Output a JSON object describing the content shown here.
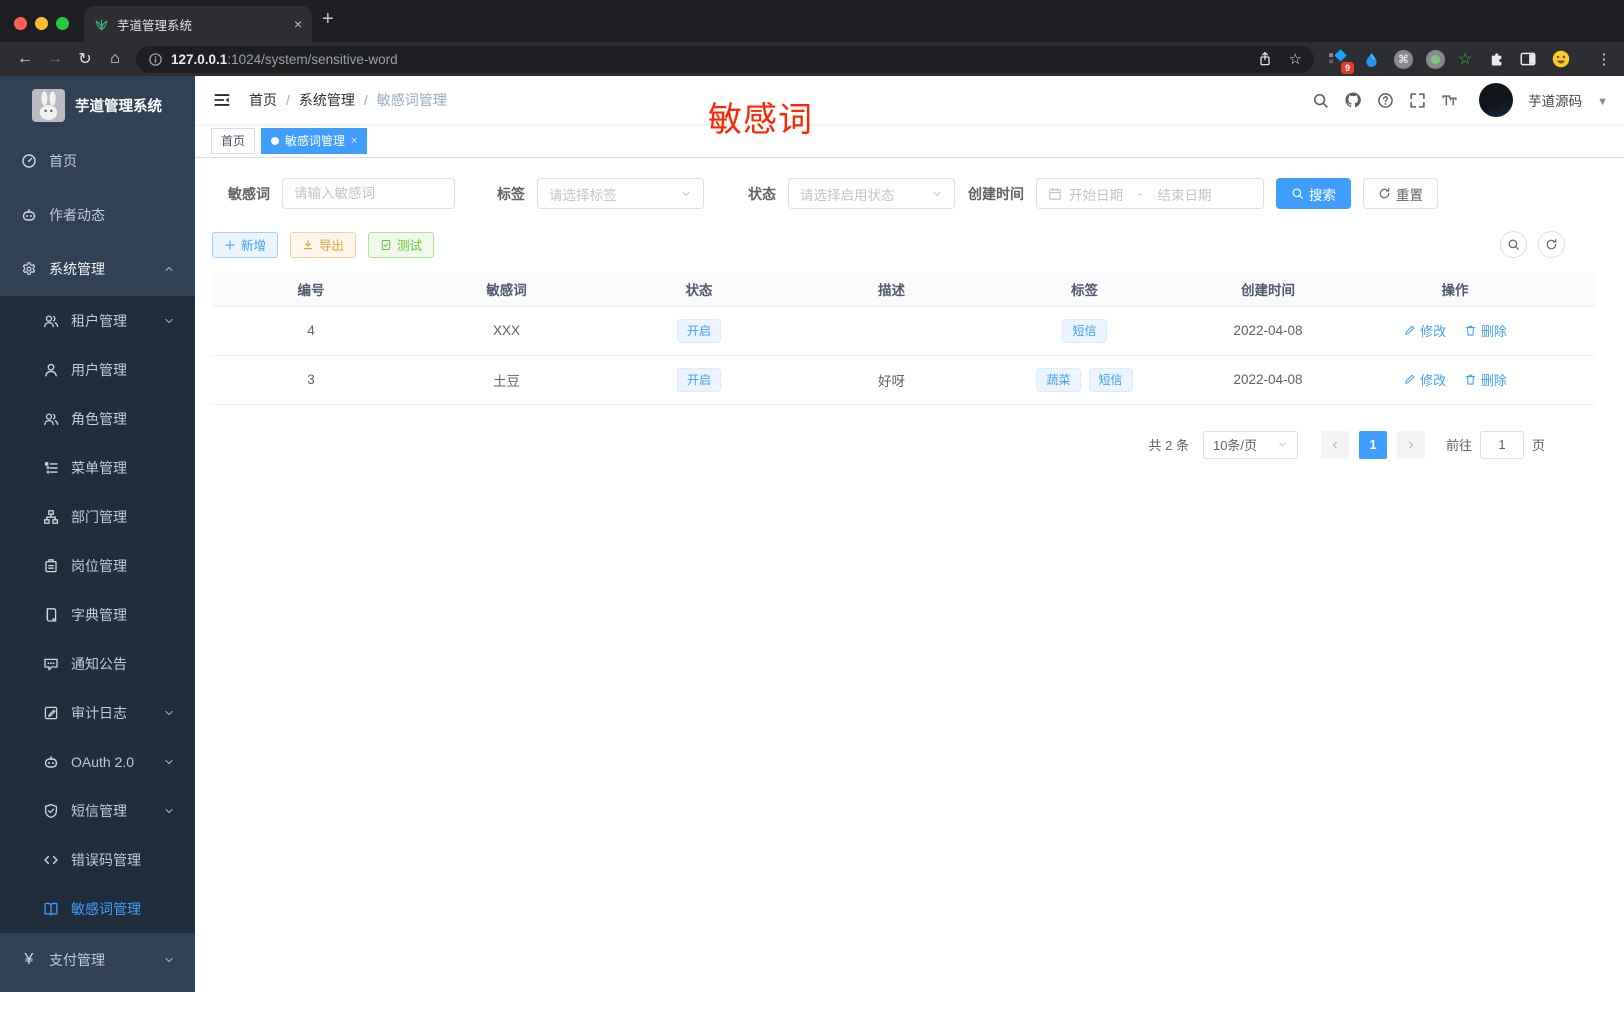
{
  "browser": {
    "tab_title": "芋道管理系统",
    "url_host": "127.0.0.1",
    "url_rest": ":1024/system/sensitive-word",
    "extension_badge": "9"
  },
  "icons": {
    "back": "←",
    "forward": "→",
    "reload": "↻",
    "home": "⌂",
    "newtab": "+",
    "tab_close": "×",
    "dots": "⋮",
    "star": "☆",
    "green_star": "☆",
    "cmd": "⌘",
    "yen": "¥",
    "tag_close": "×",
    "caret": "▼",
    "breadcrumb_sep": "/"
  },
  "sidebar": {
    "logo_title": "芋道管理系统",
    "items": [
      {
        "label": "首页"
      },
      {
        "label": "作者动态"
      },
      {
        "label": "系统管理"
      },
      {
        "label": "租户管理"
      },
      {
        "label": "用户管理"
      },
      {
        "label": "角色管理"
      },
      {
        "label": "菜单管理"
      },
      {
        "label": "部门管理"
      },
      {
        "label": "岗位管理"
      },
      {
        "label": "字典管理"
      },
      {
        "label": "通知公告"
      },
      {
        "label": "审计日志"
      },
      {
        "label": "OAuth 2.0"
      },
      {
        "label": "短信管理"
      },
      {
        "label": "错误码管理"
      },
      {
        "label": "敏感词管理"
      },
      {
        "label": "支付管理"
      }
    ]
  },
  "header": {
    "breadcrumb": [
      "首页",
      "系统管理",
      "敏感词管理"
    ],
    "user_name": "芋道源码",
    "annotation": "敏感词"
  },
  "tags_view": [
    {
      "label": "首页"
    },
    {
      "label": "敏感词管理"
    }
  ],
  "filters": {
    "word_label": "敏感词",
    "word_placeholder": "请输入敏感词",
    "tag_label": "标签",
    "tag_placeholder": "请选择标签",
    "status_label": "状态",
    "status_placeholder": "请选择启用状态",
    "created_label": "创建时间",
    "date_start": "开始日期",
    "date_separator": "-",
    "date_end": "结束日期",
    "search_label": "搜索",
    "reset_label": "重置"
  },
  "toolbar": {
    "add_label": "新增",
    "export_label": "导出",
    "test_label": "测试"
  },
  "table": {
    "columns": [
      "编号",
      "敏感词",
      "状态",
      "描述",
      "标签",
      "创建时间",
      "操作"
    ],
    "rows": [
      {
        "id": "4",
        "word": "XXX",
        "status": "开启",
        "description": "",
        "tags": [
          "短信"
        ],
        "created_at": "2022-04-08"
      },
      {
        "id": "3",
        "word": "土豆",
        "status": "开启",
        "description": "好呀",
        "tags": [
          "蔬菜",
          "短信"
        ],
        "created_at": "2022-04-08"
      }
    ],
    "action_edit": "修改",
    "action_delete": "删除"
  },
  "pagination": {
    "total": "共 2 条",
    "page_size": "10条/页",
    "current_page": "1",
    "goto_label": "前往",
    "goto_value": "1",
    "unit_label": "页"
  },
  "colors": {
    "primary": "#409eff",
    "sidebar_bg": "#304156",
    "submenu_bg": "#1f2d3d",
    "annotation_red": "#ff2600",
    "tag_bg": "#ecf5ff",
    "warning": "#e6a23c",
    "success": "#67c23a"
  }
}
